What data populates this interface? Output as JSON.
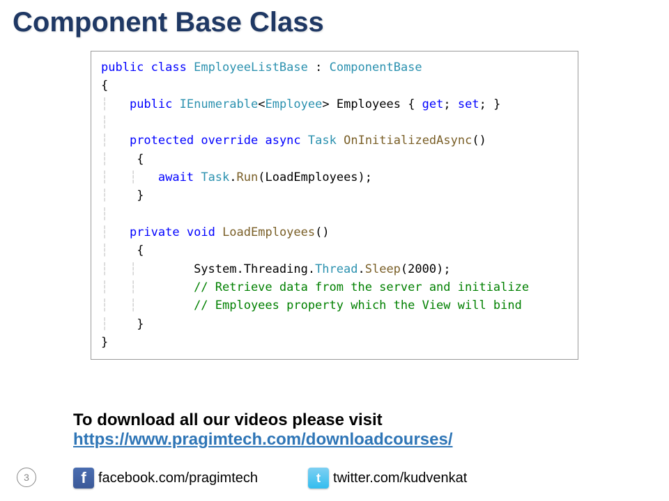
{
  "title": "Component Base Class",
  "code": {
    "l1a": "public",
    "l1b": "class",
    "l1c": "EmployeeListBase",
    "l1d": "ComponentBase",
    "l2": "{",
    "l3a": "public",
    "l3b": "IEnumerable",
    "l3c": "Employee",
    "l3d": " Employees { ",
    "l3e": "get",
    "l3f": "set",
    "l3g": "; }",
    "l5a": "protected",
    "l5b": "override",
    "l5c": "async",
    "l5d": "Task",
    "l5e": "OnInitializedAsync",
    "l6": "    {",
    "l7a": "await",
    "l7b": "Task",
    "l7c": "Run",
    "l7d": "(LoadEmployees);",
    "l8": "    }",
    "l10a": "private",
    "l10b": "void",
    "l10c": "LoadEmployees",
    "l11": "    {",
    "l12a": "        System.Threading.",
    "l12b": "Thread",
    "l12c": "Sleep",
    "l12d": "(2000);",
    "l13": "        // Retrieve data from the server and initialize",
    "l14": "        // Employees property which the View will bind",
    "l15": "    }",
    "l16": "}"
  },
  "footer": {
    "text": "To download all our videos please visit",
    "link": "https://www.pragimtech.com/downloadcourses/"
  },
  "page_number": "3",
  "social": {
    "fb_glyph": "f",
    "fb_text": "facebook.com/pragimtech",
    "tw_glyph": "t",
    "tw_text": "twitter.com/kudvenkat"
  }
}
